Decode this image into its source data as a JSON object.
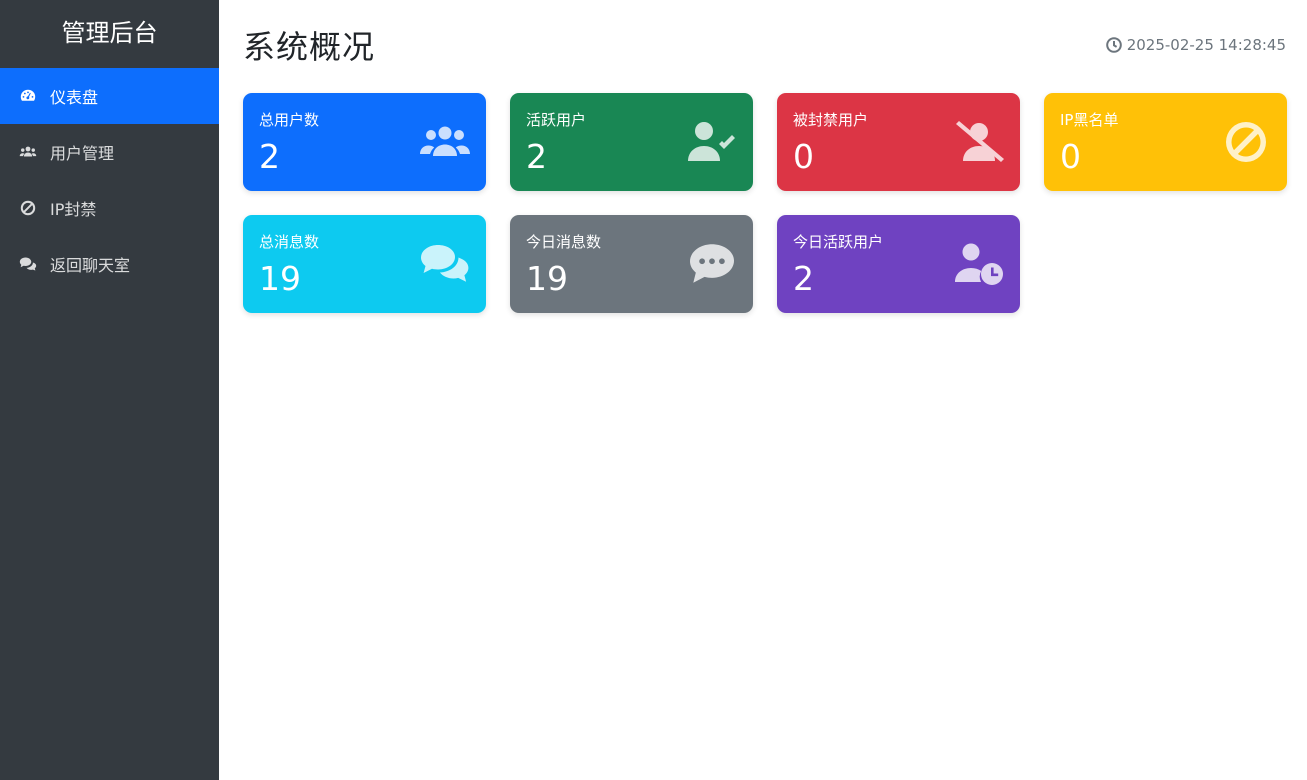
{
  "sidebar": {
    "brand": "管理后台",
    "items": [
      {
        "label": "仪表盘",
        "icon": "dashboard-icon",
        "active": true
      },
      {
        "label": "用户管理",
        "icon": "users-icon",
        "active": false
      },
      {
        "label": "IP封禁",
        "icon": "ban-icon",
        "active": false
      },
      {
        "label": "返回聊天室",
        "icon": "comments-icon",
        "active": false
      }
    ]
  },
  "header": {
    "title": "系统概况",
    "datetime": "2025-02-25 14:28:45",
    "clock_icon": "clock-icon"
  },
  "cards": [
    {
      "label": "总用户数",
      "value": "2",
      "icon": "users-icon",
      "color": "#0d6efd"
    },
    {
      "label": "活跃用户",
      "value": "2",
      "icon": "user-check-icon",
      "color": "#198754"
    },
    {
      "label": "被封禁用户",
      "value": "0",
      "icon": "user-slash-icon",
      "color": "#dc3545"
    },
    {
      "label": "IP黑名单",
      "value": "0",
      "icon": "ban-icon",
      "color": "#ffc107"
    },
    {
      "label": "总消息数",
      "value": "19",
      "icon": "comments-icon",
      "color": "#0dcaf0"
    },
    {
      "label": "今日消息数",
      "value": "19",
      "icon": "comment-dots-icon",
      "color": "#6c757d"
    },
    {
      "label": "今日活跃用户",
      "value": "2",
      "icon": "user-clock-icon",
      "color": "#6f42c1"
    }
  ]
}
